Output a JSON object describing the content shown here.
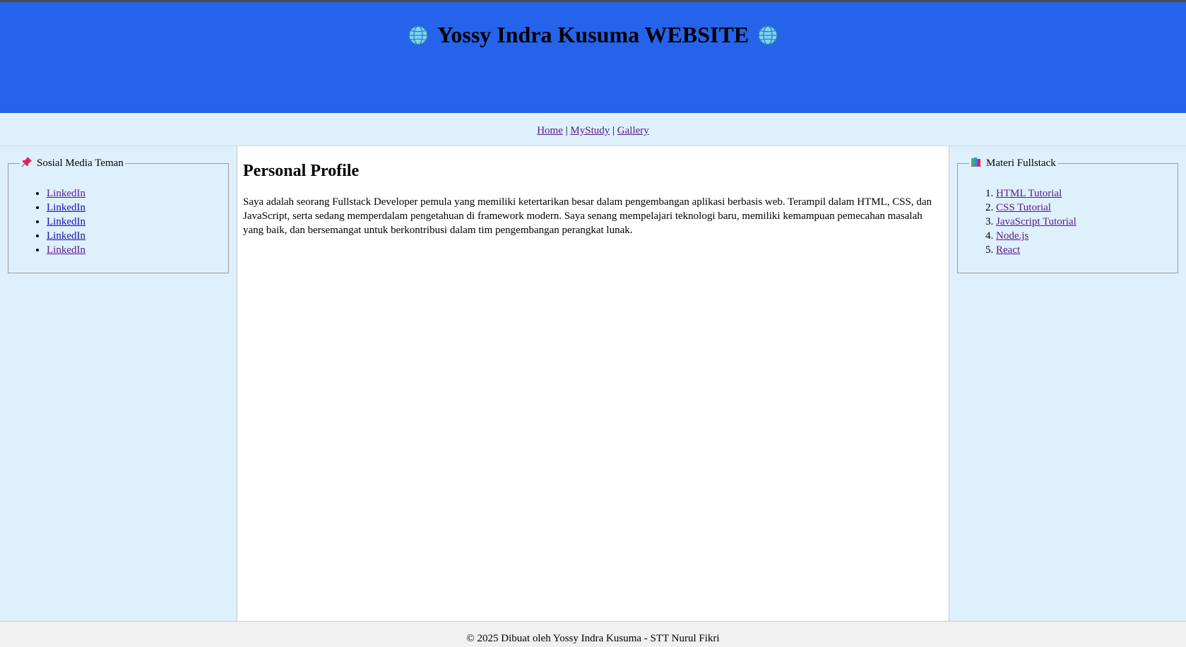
{
  "header": {
    "title": "Yossy Indra Kusuma WEBSITE",
    "icon": "globe-icon",
    "background": "#2563eb"
  },
  "nav": {
    "links": [
      "Home",
      "MyStudy",
      "Gallery"
    ],
    "separator": "|",
    "background": "#dff0fd"
  },
  "left_panel": {
    "legend": "Sosial Media Teman",
    "icon": "pushpin-icon",
    "items": [
      "LinkedIn",
      "LinkedIn",
      "LinkedIn",
      "LinkedIn",
      "LinkedIn"
    ]
  },
  "main": {
    "heading": "Personal Profile",
    "paragraph": "Saya adalah seorang Fullstack Developer pemula yang memiliki ketertarikan besar dalam pengembangan aplikasi berbasis web. Terampil dalam HTML, CSS, dan JavaScript, serta sedang memperdalam pengetahuan di framework modern. Saya senang mempelajari teknologi baru, memiliki kemampuan pemecahan masalah yang baik, dan bersemangat untuk berkontribusi dalam tim pengembangan perangkat lunak."
  },
  "right_panel": {
    "legend": "Materi Fullstack",
    "icon": "books-icon",
    "items": [
      "HTML Tutorial",
      "CSS Tutorial",
      "JavaScript Tutorial",
      "Node.js",
      "React"
    ]
  },
  "footer": {
    "text": "© 2025 Dibuat oleh Yossy Indra Kusuma - STT Nurul Fikri"
  }
}
